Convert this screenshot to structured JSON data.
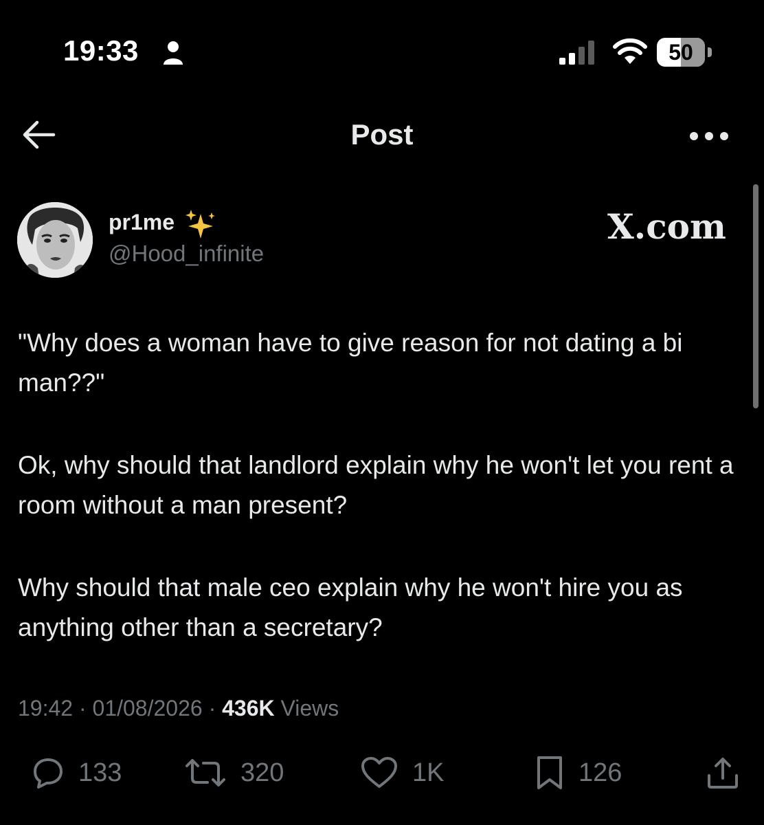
{
  "status_bar": {
    "time": "19:33",
    "battery": "50",
    "icons": [
      "person-icon",
      "cellular-signal-icon",
      "wifi-icon",
      "battery-icon"
    ]
  },
  "header": {
    "title": "Post",
    "back_icon": "back-arrow-icon",
    "more_icon": "more-options-icon"
  },
  "author": {
    "display_name": "pr1me",
    "emoji": "sparkles-icon",
    "handle": "@Hood_infinite",
    "source_badge": "X.com"
  },
  "post": {
    "paragraphs": [
      "\"Why does a woman have to give reason for not dating a bi man??\"",
      "Ok, why should that landlord explain why he won't let you rent a room without a man present?",
      "Why should that male ceo explain why he won't hire you as anything other than a secretary?"
    ],
    "time": "19:42",
    "date": "01/08/2026",
    "views_count": "436K",
    "views_label": "Views",
    "separator": "·"
  },
  "actions": {
    "replies": "133",
    "reposts": "320",
    "likes": "1K",
    "bookmarks": "126"
  },
  "colors": {
    "background": "#000000",
    "text": "#e7e9ea",
    "muted": "#71767b",
    "sparkle": "#f5c542"
  }
}
